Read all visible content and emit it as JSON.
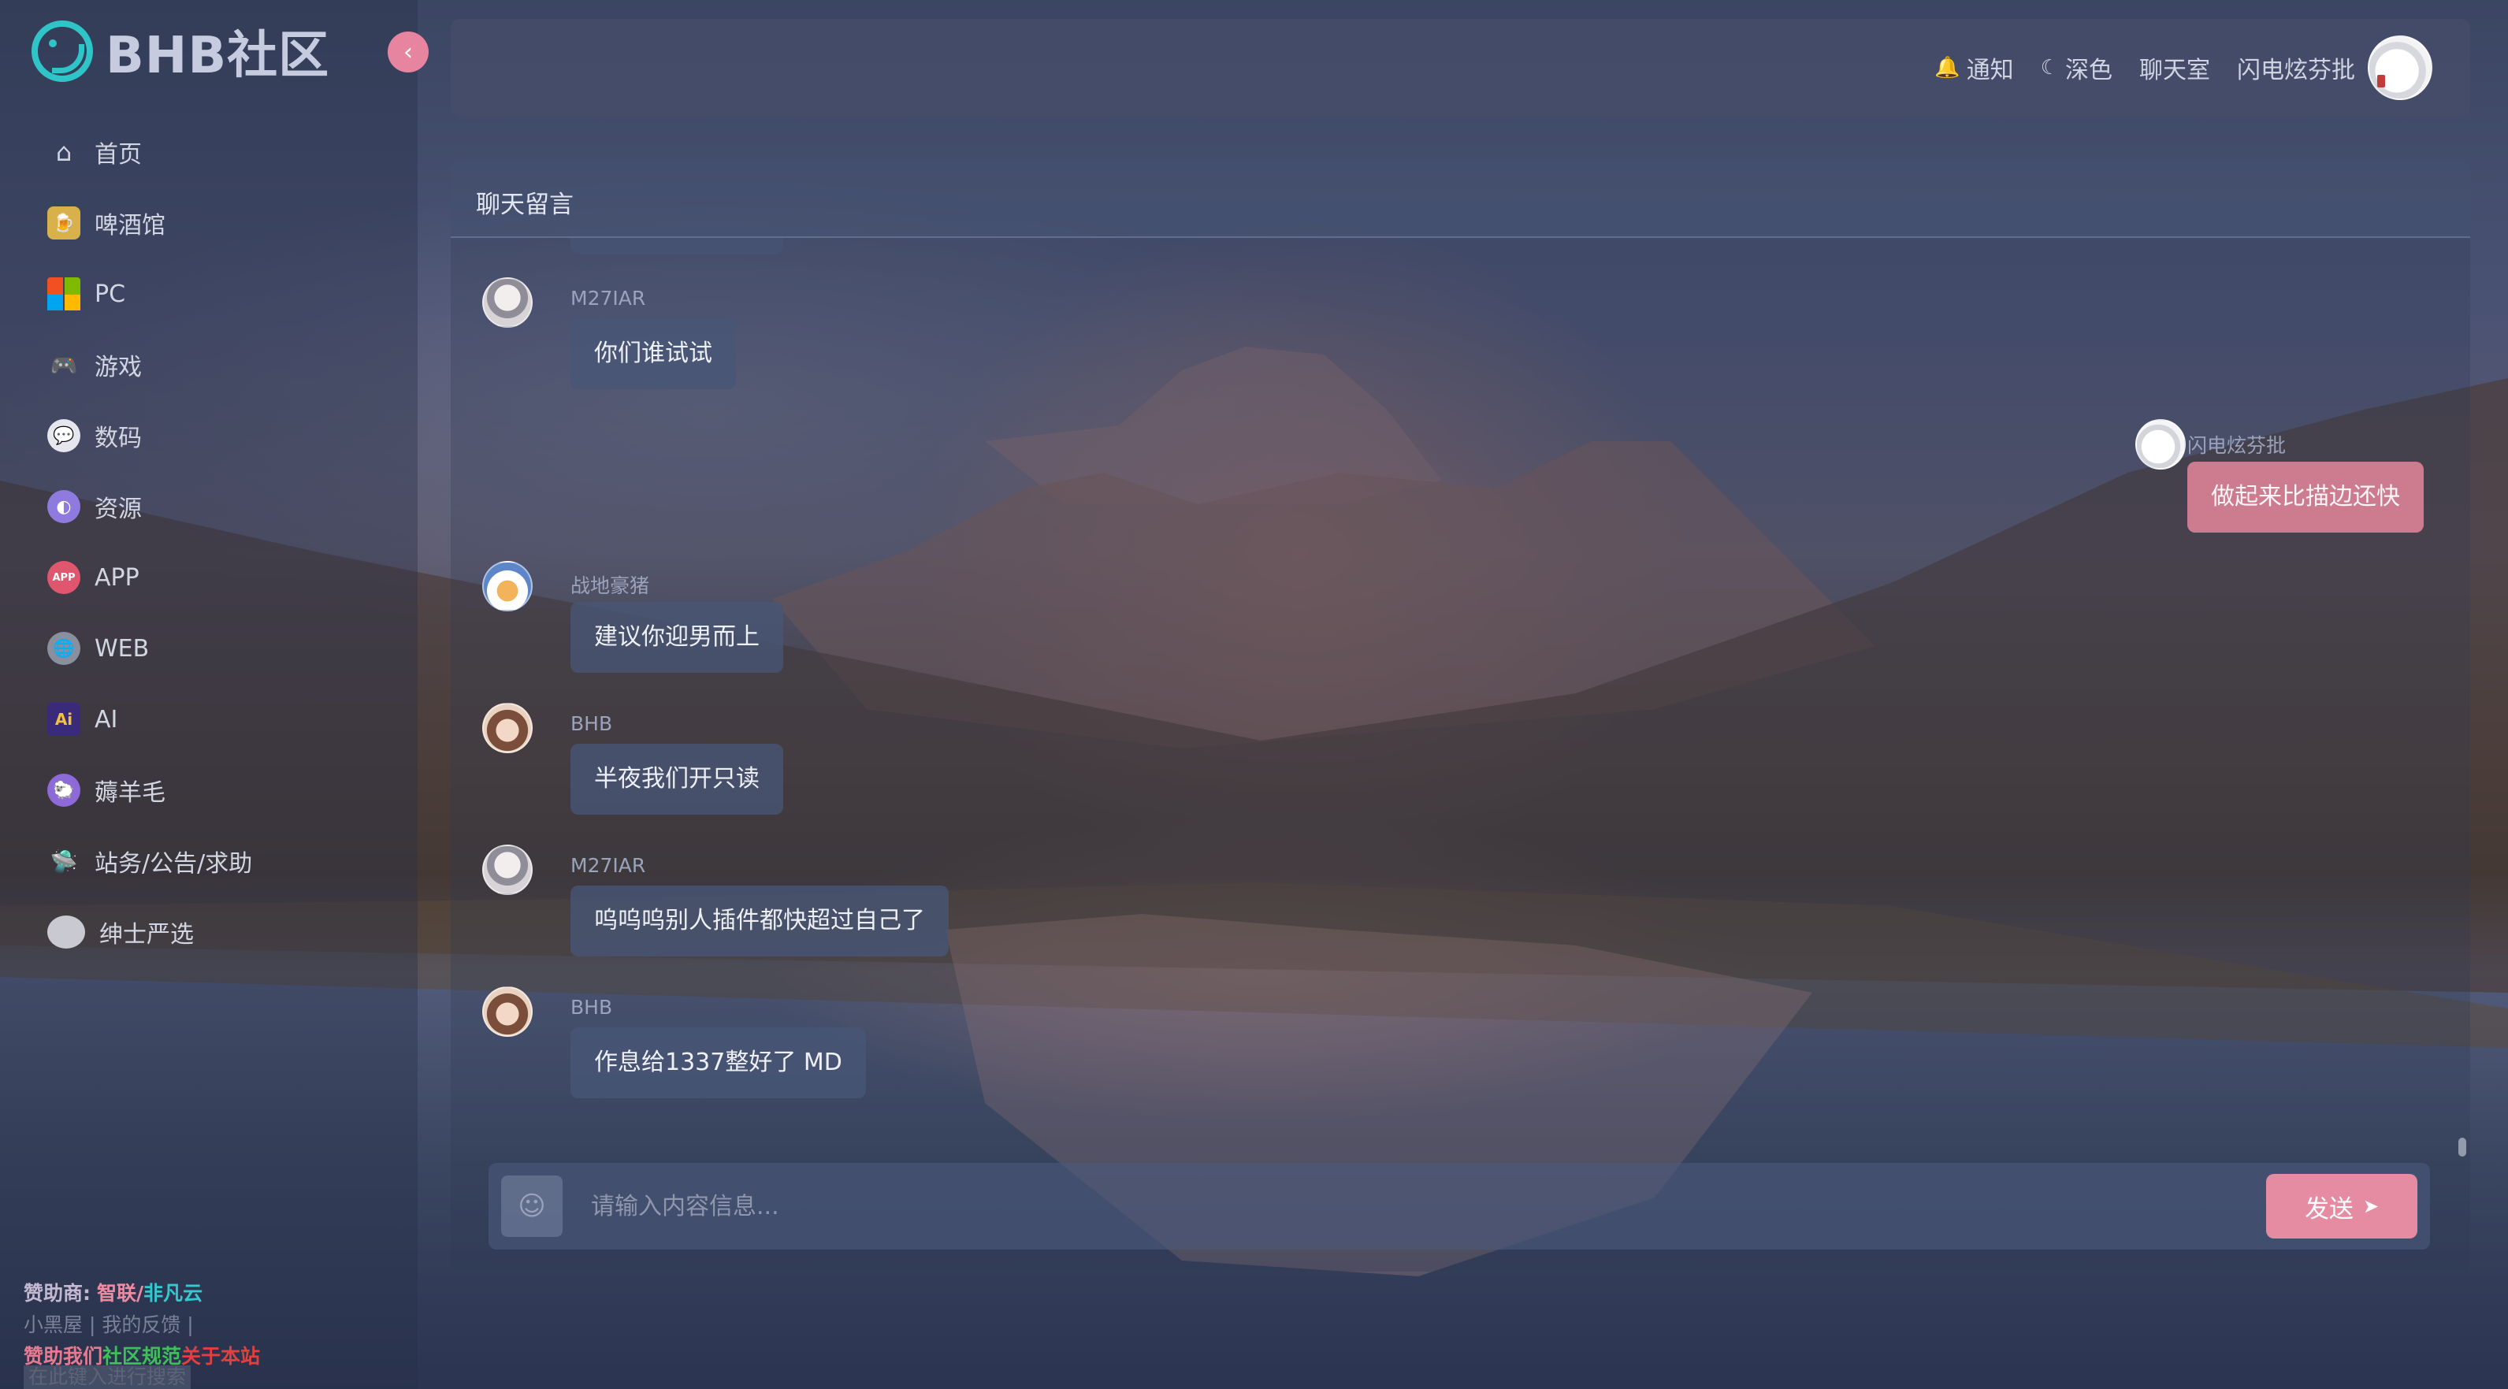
{
  "brand": {
    "name": "BHB社区",
    "accent": "#2fc4c8"
  },
  "sidebar": {
    "collapse_icon": "chevron-left-icon",
    "items": [
      {
        "label": "首页",
        "icon": "home-icon",
        "color": "transparent"
      },
      {
        "label": "啤酒馆",
        "icon": "beer-icon",
        "color": "#d8b14a"
      },
      {
        "label": "PC",
        "icon": "windows-icon",
        "color": "#3c78d8"
      },
      {
        "label": "游戏",
        "icon": "gamepad-icon",
        "color": "#e8627b"
      },
      {
        "label": "数码",
        "icon": "chat-bubble-icon",
        "color": "#e6e6ee"
      },
      {
        "label": "资源",
        "icon": "resource-icon",
        "color": "#8f7be0"
      },
      {
        "label": "APP",
        "icon": "app-icon",
        "color": "#e0566e"
      },
      {
        "label": "WEB",
        "icon": "globe-icon",
        "color": "#8a8f9e"
      },
      {
        "label": "AI",
        "icon": "ai-icon",
        "color": "#3a2a7a"
      },
      {
        "label": "薅羊毛",
        "icon": "sheep-icon",
        "color": "#8e6ad8"
      },
      {
        "label": "站务/公告/求助",
        "icon": "ufo-icon",
        "color": "#4bbf8b"
      },
      {
        "label": "绅士严选",
        "icon": "gentleman-icon",
        "color": "#c9c9d2"
      }
    ],
    "footer": {
      "sponsor_prefix": "赞助商:",
      "sponsor_a": "智联",
      "sponsor_sep": "/",
      "sponsor_b": "非凡云",
      "links_line": "小黑屋 | 我的反馈 |",
      "support": "赞助我们",
      "rules": "社区规范",
      "about": "关于本站",
      "search_hint": "在此键入进行搜索"
    }
  },
  "header": {
    "notify": "通知",
    "dark": "深色",
    "chatroom": "聊天室",
    "username": "闪电炫芬批"
  },
  "chat": {
    "title": "聊天留言",
    "messages": [
      {
        "user": "M27IAR",
        "text": "你们谁试试",
        "self": false
      },
      {
        "user": "闪电炫芬批",
        "text": "做起来比描边还快",
        "self": true
      },
      {
        "user": "战地豪猪",
        "text": "建议你迎男而上",
        "self": false
      },
      {
        "user": "BHB",
        "text": "半夜我们开只读",
        "self": false
      },
      {
        "user": "M27IAR",
        "text": "呜呜呜别人插件都快超过自己了",
        "self": false
      },
      {
        "user": "BHB",
        "text": "作息给1337整好了 MD",
        "self": false
      }
    ],
    "composer": {
      "placeholder": "请输入内容信息...",
      "send_label": "发送",
      "send_color": "#e58ca3"
    }
  }
}
